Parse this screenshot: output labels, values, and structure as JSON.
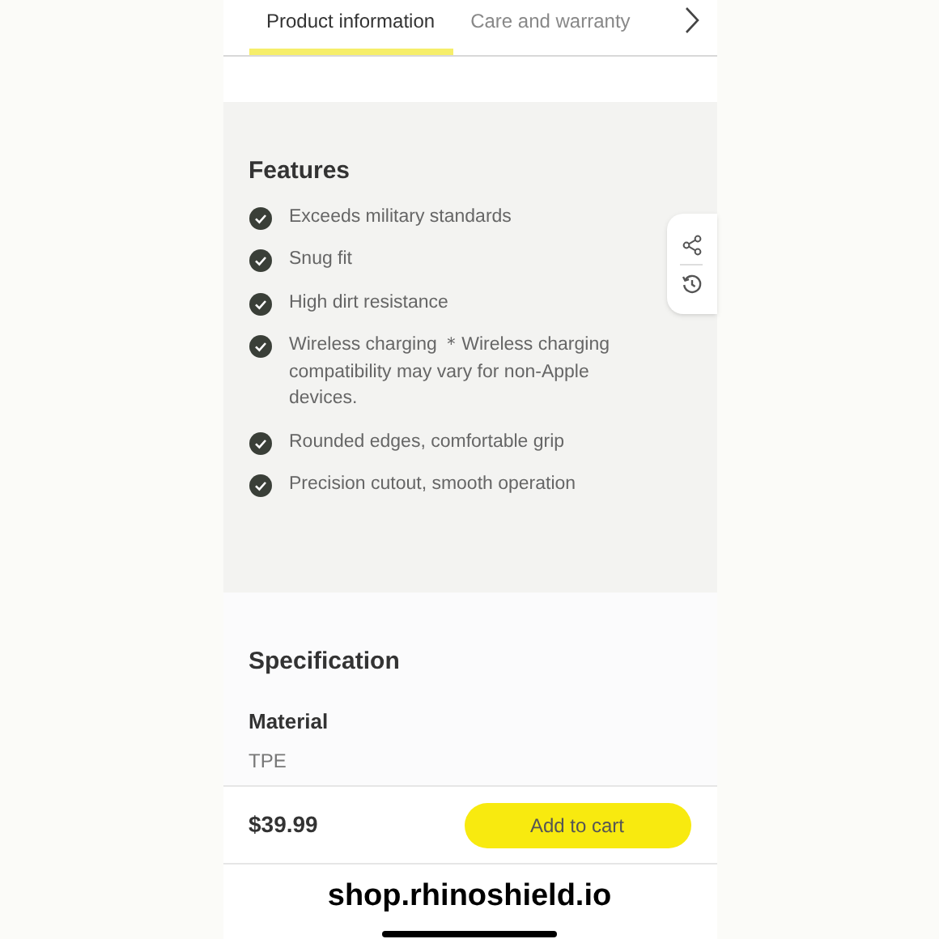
{
  "tabs": [
    {
      "label": "Product information",
      "selected": true
    },
    {
      "label": "Care and warranty",
      "selected": false
    }
  ],
  "features": {
    "title": "Features",
    "items": [
      {
        "text": "Exceeds military standards"
      },
      {
        "text": "Snug fit"
      },
      {
        "text": "High dirt resistance"
      },
      {
        "text": "Wireless charging ＊Wireless charging compatibility may vary for non-Apple devices."
      },
      {
        "text": "Rounded edges, comfortable grip"
      },
      {
        "text": "Precision cutout, smooth operation"
      }
    ]
  },
  "specification": {
    "title": "Specification",
    "label": "Material",
    "value": "TPE"
  },
  "purchase_bar": {
    "price": "$39.99",
    "button": "Add to cart"
  },
  "caption": "shop.rhinoshield.io"
}
